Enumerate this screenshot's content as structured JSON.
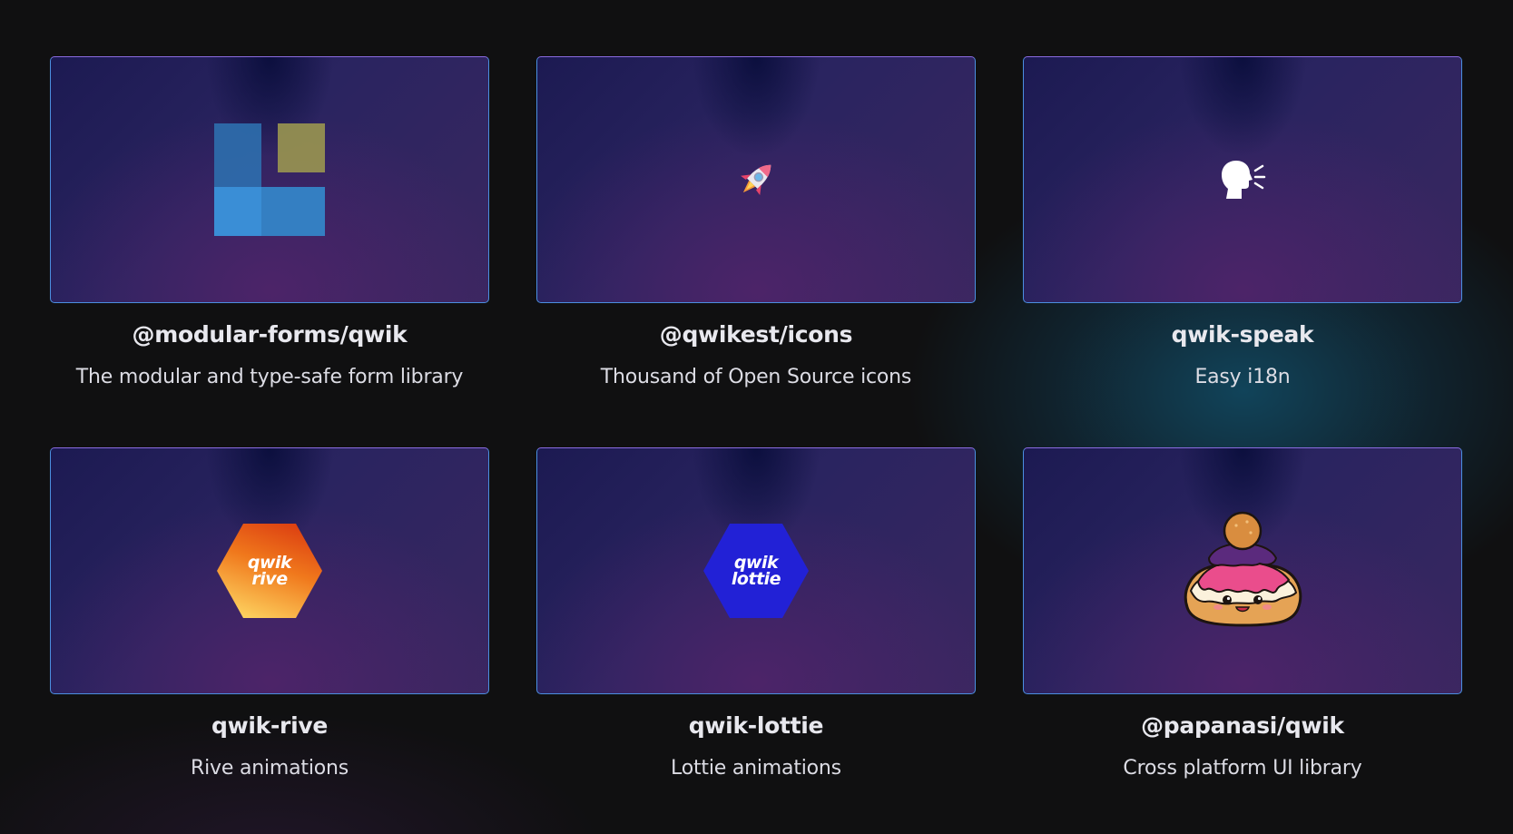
{
  "cards": [
    {
      "title": "@modular-forms/qwik",
      "description": "The modular and type-safe form library",
      "icon": "modular-forms-logo"
    },
    {
      "title": "@qwikest/icons",
      "description": "Thousand of Open Source icons",
      "icon": "rocket-icon"
    },
    {
      "title": "qwik-speak",
      "description": "Easy i18n",
      "icon": "speaking-head-icon"
    },
    {
      "title": "qwik-rive",
      "description": "Rive animations",
      "icon": "qwik-rive-logo",
      "logo_text": [
        "qwik",
        "rive"
      ]
    },
    {
      "title": "qwik-lottie",
      "description": "Lottie animations",
      "icon": "qwik-lottie-logo",
      "logo_text": [
        "qwik",
        "lottie"
      ]
    },
    {
      "title": "@papanasi/qwik",
      "description": "Cross platform UI library",
      "icon": "papanasi-mascot"
    }
  ],
  "colors": {
    "background": "#101011",
    "card_border": "#4b8fe0",
    "title_text": "#e8e8ee",
    "description_text": "#dcdce4",
    "teal_glow": "#126e96",
    "rive_gradient": [
      "#d8340f",
      "#f0781c",
      "#ffe06a"
    ],
    "lottie_blue": "#2221d6"
  }
}
